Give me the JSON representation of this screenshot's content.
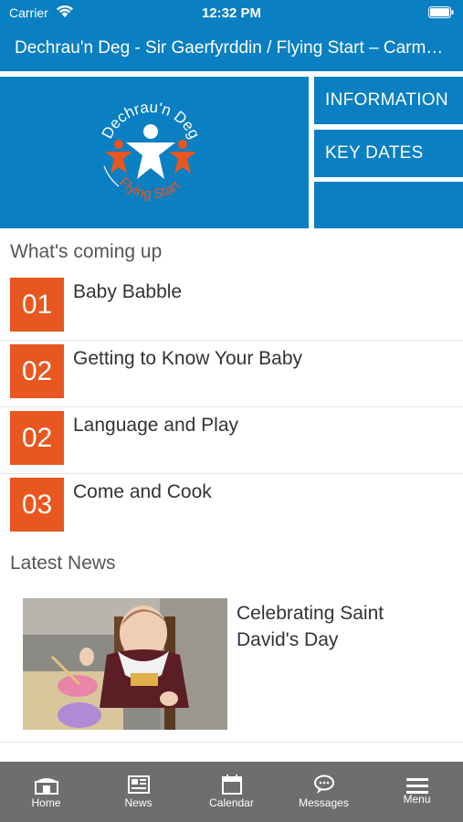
{
  "status_bar": {
    "carrier": "Carrier",
    "time": "12:32 PM"
  },
  "header": {
    "title": "Dechrau'n Deg - Sir Gaerfyrddin / Flying Start – Carmarthenshire"
  },
  "logo": {
    "top_text": "Dechrau'n Deg",
    "bottom_text": "Flying Start"
  },
  "tiles": [
    {
      "label": "INFORMATION"
    },
    {
      "label": "KEY DATES"
    },
    {
      "label": ""
    }
  ],
  "coming_up": {
    "title": "What's coming up",
    "items": [
      {
        "number": "01",
        "title": "Baby Babble"
      },
      {
        "number": "02",
        "title": "Getting to Know Your Baby"
      },
      {
        "number": "02",
        "title": "Language and Play"
      },
      {
        "number": "03",
        "title": "Come and Cook"
      }
    ]
  },
  "latest_news": {
    "title": "Latest News",
    "items": [
      {
        "title": "Celebrating Saint David's Day"
      }
    ]
  },
  "tab_bar": {
    "tabs": [
      {
        "label": "Home",
        "icon": "home-icon"
      },
      {
        "label": "News",
        "icon": "news-icon"
      },
      {
        "label": "Calendar",
        "icon": "calendar-icon"
      },
      {
        "label": "Messages",
        "icon": "messages-icon"
      },
      {
        "label": "Menu",
        "icon": "menu-icon"
      }
    ]
  },
  "colors": {
    "brand_blue": "#0a7fc2",
    "accent_orange": "#e8571f",
    "tab_bar": "#6e6e6e"
  }
}
